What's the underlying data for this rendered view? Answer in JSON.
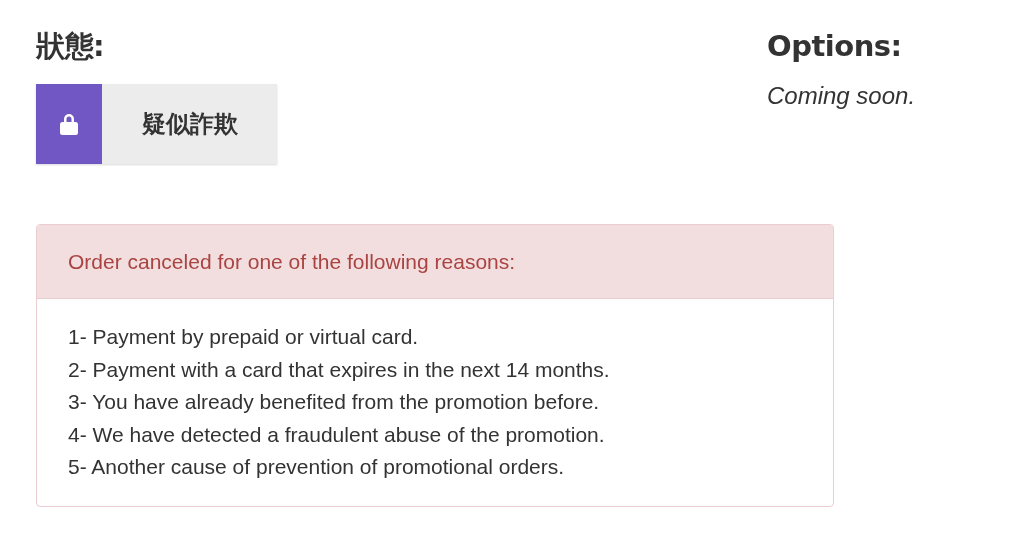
{
  "status": {
    "heading": "狀態:",
    "badge": {
      "label": "疑似詐欺"
    }
  },
  "options": {
    "heading": "Options:",
    "text": "Coming soon."
  },
  "alert": {
    "title": "Order canceled for one of the following reasons:",
    "lines": [
      "1- Payment by prepaid or virtual card.",
      "2- Payment with a card that expires in the next 14 months.",
      "3- You have already benefited from the promotion before.",
      "4- We have detected a fraudulent abuse of the promotion.",
      "5- Another cause of prevention of promotional orders."
    ]
  }
}
